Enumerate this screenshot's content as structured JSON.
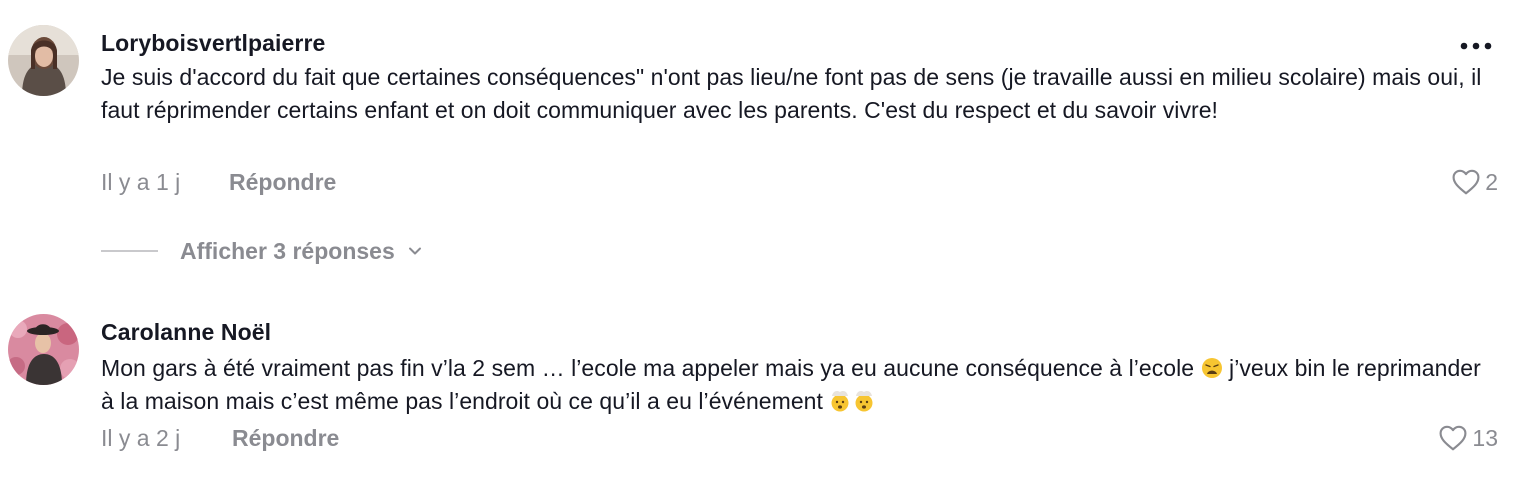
{
  "comments": [
    {
      "username": "Loryboisvertlpaierre",
      "text": "Je suis d'accord du fait que certaines conséquences\" n'ont pas lieu/ne font pas de sens (je travaille aussi en milieu scolaire) mais oui, il faut réprimender certains enfant et on doit communiquer avec les parents. C'est du respect et du savoir vivre!",
      "time": "Il y a 1 j",
      "reply_label": "Répondre",
      "likes": "2",
      "replies_label": "Afficher 3 réponses"
    },
    {
      "username": "Carolanne Noël",
      "text_part1": "Mon gars à été vraiment pas fin v’la 2 sem … l’ecole ma appeler mais ya eu aucune conséquence à l’ecole",
      "text_part2": "j’veux bin le reprimander à la maison mais c’est même pas l’endroit où ce qu’il a eu l’événement",
      "emoji1": "😩",
      "emoji2": "🤯🤯",
      "time": "Il y a 2 j",
      "reply_label": "Répondre",
      "likes": "13"
    }
  ],
  "icons": {
    "more": "more-horizontal-icon",
    "like": "heart-outline-icon",
    "chevron": "chevron-down-icon",
    "emoji_weary": "weary-face-emoji",
    "emoji_exploding": "exploding-head-emoji"
  },
  "colors": {
    "text": "#161823",
    "secondary": "#8a8b91",
    "divider": "#c9c9cc"
  }
}
